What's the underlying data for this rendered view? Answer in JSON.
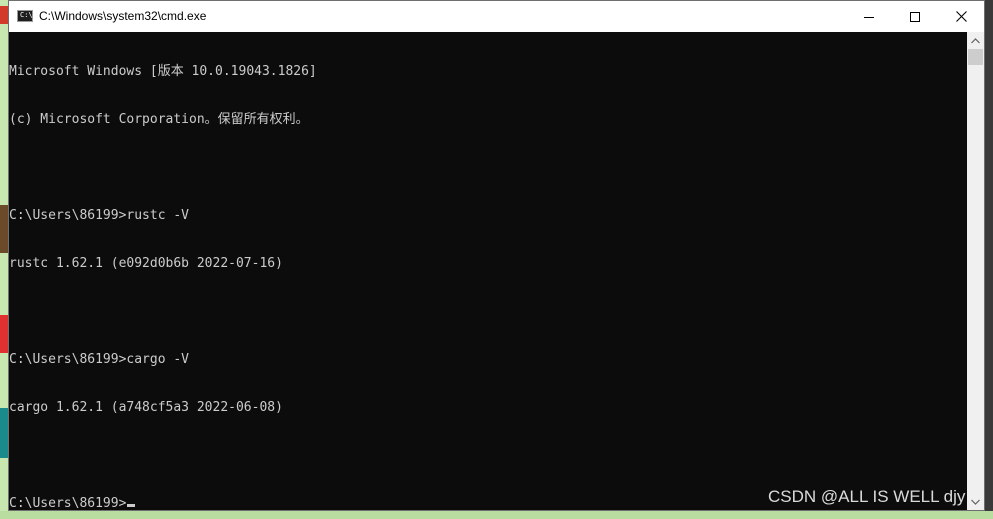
{
  "window": {
    "title": "C:\\Windows\\system32\\cmd.exe",
    "app_icon": "cmd-icon",
    "app_icon_glyph": "C:\\",
    "controls": {
      "minimize_icon": "minimize-icon",
      "maximize_icon": "maximize-icon",
      "close_icon": "close-icon"
    }
  },
  "console": {
    "lines": [
      "Microsoft Windows [版本 10.0.19043.1826]",
      "(c) Microsoft Corporation。保留所有权利。",
      "",
      "C:\\Users\\86199>rustc -V",
      "rustc 1.62.1 (e092d0b6b 2022-07-16)",
      "",
      "C:\\Users\\86199>cargo -V",
      "cargo 1.62.1 (a748cf5a3 2022-06-08)",
      "",
      "C:\\Users\\86199>"
    ],
    "colors": {
      "background": "#0c0c0c",
      "text": "#cccccc"
    }
  },
  "scrollbar": {
    "up_icon": "scroll-up-arrow-icon",
    "down_icon": "scroll-down-arrow-icon"
  },
  "watermark": {
    "text": "CSDN @ALL IS WELL djy"
  }
}
